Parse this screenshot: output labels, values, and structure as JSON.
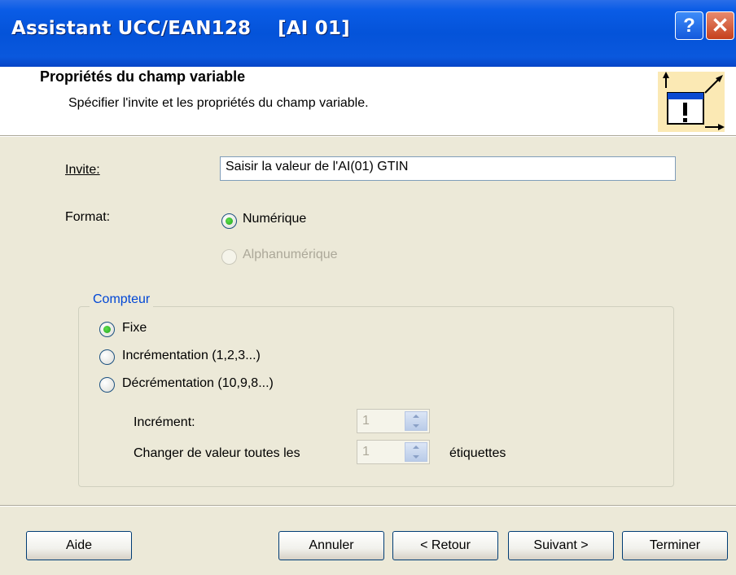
{
  "window": {
    "title": "Assistant UCC/EAN128    [AI 01]",
    "help_label": "?",
    "close_label": "✕"
  },
  "header": {
    "title": "Propriétés du champ variable",
    "subtitle": "Spécifier l'invite et les propriétés du champ variable.",
    "icon": "wizard-resize-warning-icon"
  },
  "form": {
    "invite_label": "Invite:",
    "invite_value": "Saisir la valeur de l'AI(01) GTIN",
    "format_label": "Format:",
    "format_options": [
      {
        "label": "Numérique",
        "selected": true,
        "enabled": true
      },
      {
        "label": "Alphanumérique",
        "selected": false,
        "enabled": false
      }
    ]
  },
  "counter": {
    "caption": "Compteur",
    "options": [
      {
        "label": "Fixe",
        "selected": true
      },
      {
        "label": "Incrémentation (1,2,3...)",
        "selected": false
      },
      {
        "label": "Décrémentation (10,9,8...)",
        "selected": false
      }
    ],
    "increment_label": "Incrément:",
    "increment_value": "1",
    "change_label": "Changer de valeur toutes les",
    "change_value": "1",
    "change_suffix": "étiquettes"
  },
  "buttons": {
    "help": "Aide",
    "cancel": "Annuler",
    "back": "< Retour",
    "next": "Suivant >",
    "finish": "Terminer"
  },
  "colors": {
    "titlebar": "#0453d9",
    "dialog_bg": "#ece9d8",
    "group_caption": "#0046d5"
  }
}
